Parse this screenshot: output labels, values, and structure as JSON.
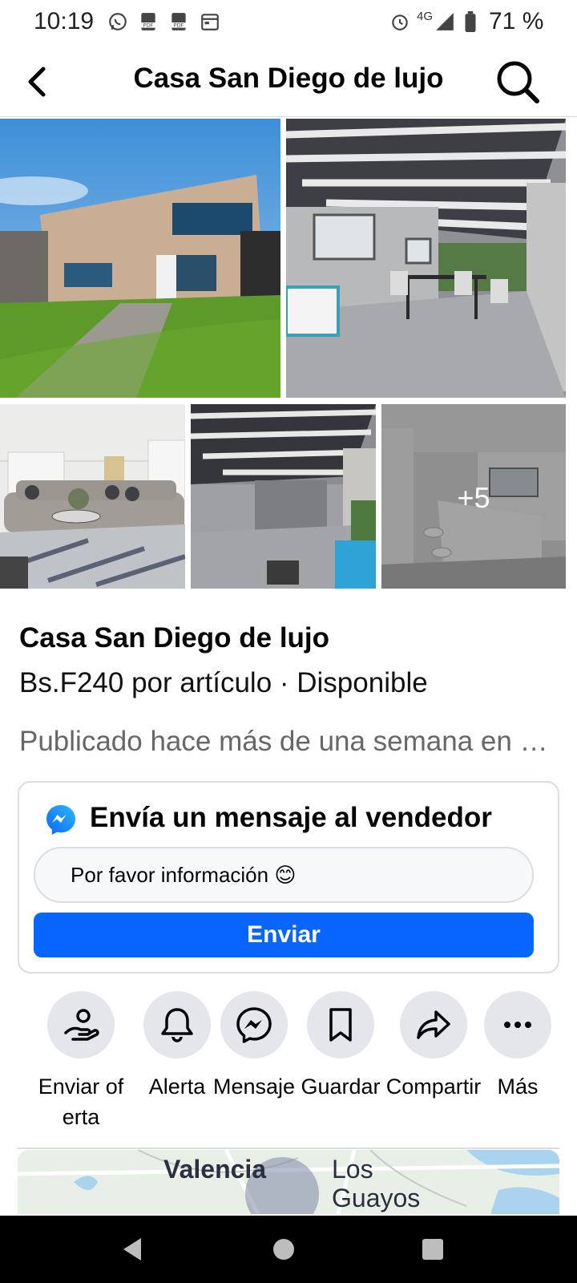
{
  "status_bar": {
    "time": "10:19",
    "network": "4G",
    "battery": "71 %",
    "icons": [
      "whatsapp-icon",
      "pdf-icon",
      "pdf-icon",
      "calendar-icon",
      "alarm-icon",
      "signal-icon",
      "battery-icon"
    ]
  },
  "header": {
    "title": "Casa San Diego de lujo"
  },
  "photos": {
    "more_count": "+5"
  },
  "listing": {
    "title": "Casa San Diego de lujo",
    "price_line": "Bs.F240 por artículo · Disponible",
    "posted": "Publicado hace más de una semana en San Diego"
  },
  "message": {
    "header": "Envía un mensaje al vendedor",
    "input_value": "Por favor información 😊",
    "send_label": "Enviar"
  },
  "actions": [
    {
      "label": "Enviar oferta",
      "icon": "hand-offer-icon"
    },
    {
      "label": "Alerta",
      "icon": "bell-icon"
    },
    {
      "label": "Mensaje",
      "icon": "messenger-icon"
    },
    {
      "label": "Guardar",
      "icon": "bookmark-icon"
    },
    {
      "label": "Compartir",
      "icon": "share-icon"
    },
    {
      "label": "Más",
      "icon": "more-icon"
    }
  ],
  "map": {
    "place_1": "Valencia",
    "place_2": "Los Guayos"
  },
  "colors": {
    "accent": "#0866ff",
    "secondary_text": "#65676b",
    "circle_bg": "#e4e6eb"
  }
}
